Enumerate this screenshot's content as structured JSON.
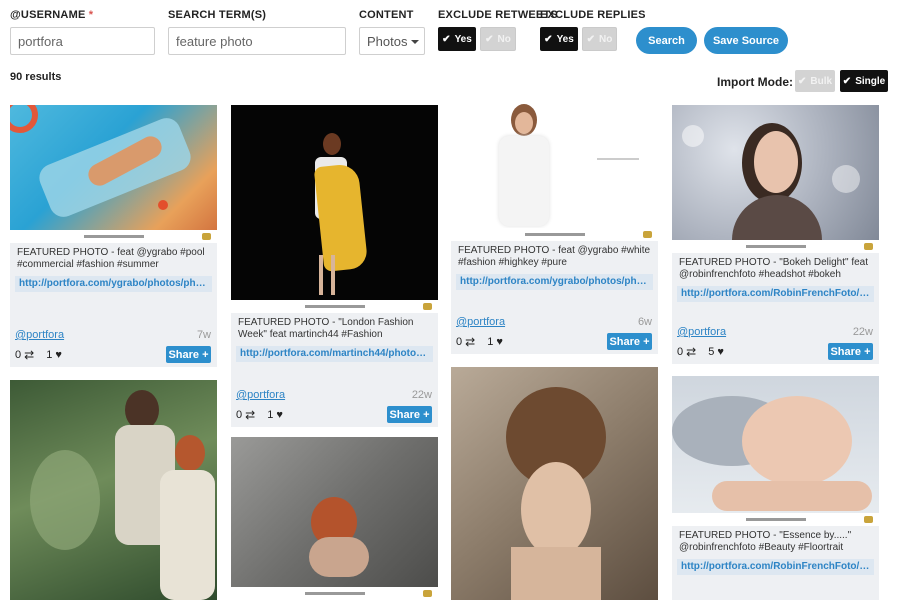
{
  "filters": {
    "username": {
      "label": "@USERNAME",
      "required_mark": "*",
      "value": "portfora"
    },
    "search": {
      "label": "SEARCH TERM(S)",
      "value": "feature photo"
    },
    "content": {
      "label": "CONTENT",
      "selected": "Photos"
    },
    "exclude_retweets": {
      "label": "EXCLUDE RETWEETS",
      "yes": "Yes",
      "no": "No",
      "selected": "Yes"
    },
    "exclude_replies": {
      "label": "EXCLUDE REPLIES",
      "yes": "Yes",
      "no": "No",
      "selected": "Yes"
    },
    "search_button": "Search",
    "save_button": "Save Source"
  },
  "results_count": "90 results",
  "import_mode": {
    "label": "Import Mode:",
    "bulk": "Bulk",
    "single": "Single",
    "selected": "Single"
  },
  "cards": [
    {
      "caption": "FEATURED PHOTO - feat @ygrabo #pool #commercial #fashion #summer",
      "link": "http://portfora.com/ygrabo/photos/photog...",
      "user": "@portfora",
      "age": "7w",
      "retweets": "0",
      "likes": "1",
      "share": "Share +",
      "image": "pool-fashion-photo"
    },
    {
      "caption": "FEATURED PHOTO - \"London Fashion Week\" feat martinch44 #Fashion",
      "link": "http://portfora.com/martinch44/photos/ph...",
      "user": "@portfora",
      "age": "22w",
      "retweets": "0",
      "likes": "1",
      "share": "Share +",
      "image": "yellow-coat-photo"
    },
    {
      "caption": "FEATURED PHOTO - feat @ygrabo #white #fashion #highkey #pure",
      "link": "http://portfora.com/ygrabo/photos/photog...",
      "user": "@portfora",
      "age": "6w",
      "retweets": "0",
      "likes": "1",
      "share": "Share +",
      "image": "white-highkey-photo"
    },
    {
      "caption": "FEATURED PHOTO - \"Bokeh Delight\" feat @robinfrenchfoto #headshot #bokeh",
      "link": "http://portfora.com/RobinFrenchFoto/pho...",
      "user": "@portfora",
      "age": "22w",
      "retweets": "0",
      "likes": "5",
      "share": "Share +",
      "image": "bokeh-headshot-photo"
    },
    {
      "caption": "",
      "link": "",
      "user": "",
      "age": "",
      "retweets": "",
      "likes": "",
      "share": "",
      "image": "garden-brides-photo"
    },
    {
      "caption": "",
      "link": "",
      "user": "",
      "age": "",
      "retweets": "",
      "likes": "",
      "share": "",
      "image": "grunge-portrait-photo"
    },
    {
      "caption": "",
      "link": "",
      "user": "",
      "age": "",
      "retweets": "",
      "likes": "",
      "share": "",
      "image": "updo-hair-photo"
    },
    {
      "caption": "FEATURED PHOTO - \"Essence by.....\" @robinfrenchfoto #Beauty #Floortrait",
      "link": "http://portfora.com/RobinFrenchFoto/pho...",
      "user": "",
      "age": "",
      "retweets": "",
      "likes": "",
      "share": "",
      "image": "beauty-closeup-photo"
    }
  ]
}
